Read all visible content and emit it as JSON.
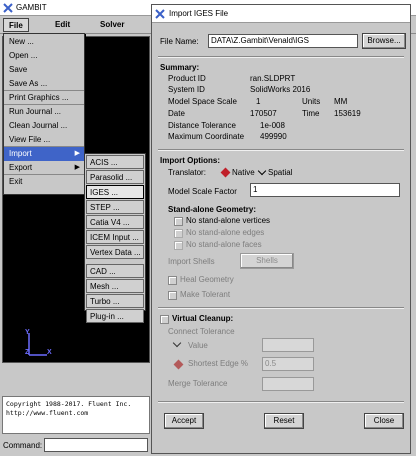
{
  "app": {
    "title": "GAMBIT"
  },
  "menubar": {
    "file": "File",
    "edit": "Edit",
    "solver": "Solver"
  },
  "file_menu": [
    "New ...",
    "Open ...",
    "Save",
    "Save As ...",
    "Print Graphics ...",
    "Run Journal ...",
    "Clean Journal ...",
    "View File ...",
    "Import",
    "Export",
    "Exit"
  ],
  "import_menu": [
    "ACIS ...",
    "Parasolid ...",
    "IGES ...",
    "STEP ...",
    "Catia V4 ...",
    "ICEM Input ...",
    "Vertex Data ...",
    "CAD ...",
    "Mesh ...",
    "Turbo ...",
    "Plug-in ..."
  ],
  "axes": {
    "y": "Y",
    "x": "X",
    "z": "Z"
  },
  "transcript": {
    "line1": "Copyright 1988-2017. Fluent Inc.",
    "line2": "http://www.fluent.com"
  },
  "command": {
    "label": "Command:",
    "value": ""
  },
  "dialog": {
    "title": "Import IGES File",
    "file_name_label": "File Name:",
    "file_name_value": "DATA\\Z.Gambit\\Venald\\IGS",
    "browse": "Browse...",
    "summary": {
      "heading": "Summary:",
      "product_id_label": "Product ID",
      "product_id": "ran.SLDPRT",
      "system_id_label": "System ID",
      "system_id": "SolidWorks 2016",
      "scale_label": "Model Space Scale",
      "scale": "1",
      "units_label": "Units",
      "units": "MM",
      "date_label": "Date",
      "date": "170507",
      "time_label": "Time",
      "time": "153619",
      "tol_label": "Distance Tolerance",
      "tol": "1e-008",
      "max_label": "Maximum Coordinate",
      "max": "499990"
    },
    "options": {
      "heading": "Import Options:",
      "translator_label": "Translator:",
      "native": "Native",
      "spatial": "Spatial",
      "scale_factor_label": "Model Scale Factor",
      "scale_factor_value": "1",
      "standalone_heading": "Stand-alone Geometry:",
      "no_vertices": "No stand-alone vertices",
      "no_edges": "No stand-alone edges",
      "no_faces": "No stand-alone faces",
      "import_shells_label": "Import Shells",
      "import_shells_value": "Shells",
      "heal_geometry": "Heal Geometry",
      "make_tolerant": "Make Tolerant"
    },
    "cleanup": {
      "heading": "Virtual Cleanup:",
      "connect_tolerance": "Connect Tolerance",
      "value_label": "Value",
      "value": "",
      "shortest_label": "Shortest Edge %",
      "shortest_value": "0.5",
      "merge_label": "Merge Tolerance",
      "merge_value": ""
    },
    "buttons": {
      "accept": "Accept",
      "reset": "Reset",
      "close": "Close"
    }
  },
  "colors": {
    "menu_highlight": "#3f64c8",
    "axis": "#6c6cff",
    "native_diamond": "#c0202a"
  }
}
